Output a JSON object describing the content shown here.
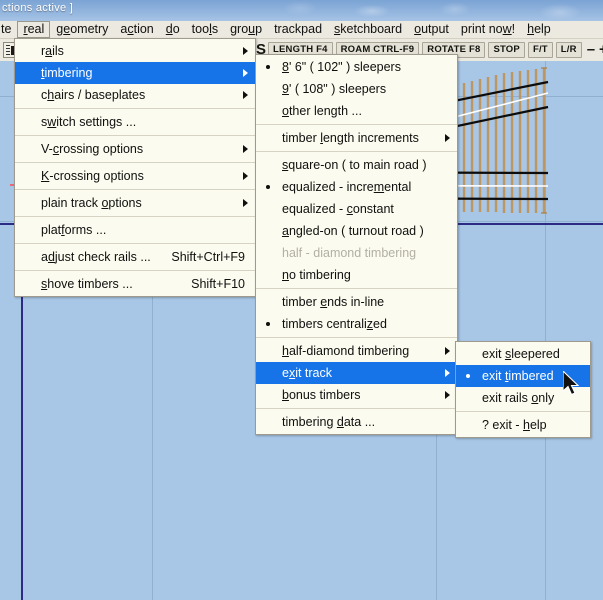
{
  "window": {
    "title_fragment": "ctions  active  ]"
  },
  "menubar": {
    "items": [
      {
        "label": "te",
        "clipped": true,
        "active": false,
        "accel": ""
      },
      {
        "label": "real",
        "clipped": false,
        "active": true,
        "accel": "r"
      },
      {
        "label": "geometry",
        "clipped": false,
        "active": false,
        "accel": "e"
      },
      {
        "label": "action",
        "clipped": false,
        "active": false,
        "accel": "c"
      },
      {
        "label": "do",
        "clipped": false,
        "active": false,
        "accel": "d"
      },
      {
        "label": "tools",
        "clipped": false,
        "active": false,
        "accel": "l"
      },
      {
        "label": "group",
        "clipped": false,
        "active": false,
        "accel": "u"
      },
      {
        "label": "trackpad",
        "clipped": false,
        "active": false,
        "accel": ""
      },
      {
        "label": "sketchboard",
        "clipped": false,
        "active": false,
        "accel": "s"
      },
      {
        "label": "output",
        "clipped": false,
        "active": false,
        "accel": "o"
      },
      {
        "label": "print now!",
        "clipped": false,
        "active": false,
        "accel": "w"
      },
      {
        "label": "help",
        "clipped": false,
        "active": false,
        "accel": "h"
      }
    ]
  },
  "toolbar": {
    "clipped_label": "S",
    "buttons": [
      {
        "label": "LENGTH  F4",
        "name": "length-f4-button"
      },
      {
        "label": "ROAM  CTRL-F9",
        "name": "roam-ctrl-f9-button"
      },
      {
        "label": "ROTATE  F8",
        "name": "rotate-f8-button"
      },
      {
        "label": "STOP",
        "name": "stop-button"
      },
      {
        "label": "F/T",
        "name": "f-over-t-button"
      },
      {
        "label": "L/R",
        "name": "l-over-r-button"
      }
    ],
    "zoom_out": "–",
    "zoom_in": "+",
    "flip_icon": "◀▶",
    "adjust_icon": "+"
  },
  "menu_real": {
    "items": [
      {
        "label": "rails",
        "pre": "r",
        "acc": "a",
        "post": "ils",
        "arrow": true,
        "bullet": false,
        "shortcut": "",
        "sep_after": false,
        "state": "normal"
      },
      {
        "label": "timbering",
        "pre": "",
        "acc": "t",
        "post": "imbering",
        "arrow": true,
        "bullet": false,
        "shortcut": "",
        "sep_after": false,
        "state": "highlight"
      },
      {
        "label": "chairs / baseplates",
        "pre": "c",
        "acc": "h",
        "post": "airs / baseplates",
        "arrow": true,
        "bullet": false,
        "shortcut": "",
        "sep_after": true,
        "state": "normal"
      },
      {
        "label": "switch  settings ...",
        "pre": "s",
        "acc": "w",
        "post": "itch  settings ...",
        "arrow": false,
        "bullet": false,
        "shortcut": "",
        "sep_after": true,
        "state": "normal"
      },
      {
        "label": "V-crossing  options",
        "pre": "V-",
        "acc": "c",
        "post": "rossing  options",
        "arrow": true,
        "bullet": false,
        "shortcut": "",
        "sep_after": true,
        "state": "normal"
      },
      {
        "label": "K-crossing  options",
        "pre": "",
        "acc": "K",
        "post": "-crossing  options",
        "arrow": true,
        "bullet": false,
        "shortcut": "",
        "sep_after": true,
        "state": "normal"
      },
      {
        "label": "plain  track  options",
        "pre": "plain  track  ",
        "acc": "o",
        "post": "ptions",
        "arrow": true,
        "bullet": false,
        "shortcut": "",
        "sep_after": true,
        "state": "normal"
      },
      {
        "label": "platforms ...",
        "pre": "plat",
        "acc": "f",
        "post": "orms ...",
        "arrow": false,
        "bullet": false,
        "shortcut": "",
        "sep_after": true,
        "state": "normal"
      },
      {
        "label": "adjust  check  rails ...",
        "pre": "a",
        "acc": "d",
        "post": "just  check  rails ...",
        "arrow": false,
        "bullet": false,
        "shortcut": "Shift+Ctrl+F9",
        "sep_after": true,
        "state": "normal"
      },
      {
        "label": "shove  timbers ...",
        "pre": "",
        "acc": "s",
        "post": "hove  timbers ...",
        "arrow": false,
        "bullet": false,
        "shortcut": "Shift+F10",
        "sep_after": false,
        "state": "normal"
      }
    ]
  },
  "menu_timbering": {
    "items": [
      {
        "label": "8' 6\"  ( 102\" )  sleepers",
        "pre": "",
        "acc": "8",
        "post": "' 6\"  ( 102\" )  sleepers",
        "arrow": false,
        "bullet": true,
        "sep_after": false,
        "state": "normal"
      },
      {
        "label": "9'  ( 108\" )  sleepers",
        "pre": "",
        "acc": "9",
        "post": "'  ( 108\" )  sleepers",
        "arrow": false,
        "bullet": false,
        "sep_after": false,
        "state": "normal"
      },
      {
        "label": "other  length ...",
        "pre": "",
        "acc": "o",
        "post": "ther  length ...",
        "arrow": false,
        "bullet": false,
        "sep_after": true,
        "state": "normal"
      },
      {
        "label": "timber  length  increments",
        "pre": "timber  ",
        "acc": "l",
        "post": "ength  increments",
        "arrow": true,
        "bullet": false,
        "sep_after": true,
        "state": "normal"
      },
      {
        "label": "square-on  ( to  main  road )",
        "pre": "",
        "acc": "s",
        "post": "quare-on  ( to  main  road )",
        "arrow": false,
        "bullet": false,
        "sep_after": false,
        "state": "normal"
      },
      {
        "label": "equalized - incremental",
        "pre": "equalized - incre",
        "acc": "m",
        "post": "ental",
        "arrow": false,
        "bullet": true,
        "sep_after": false,
        "state": "normal"
      },
      {
        "label": "equalized - constant",
        "pre": "equalized - ",
        "acc": "c",
        "post": "onstant",
        "arrow": false,
        "bullet": false,
        "sep_after": false,
        "state": "normal"
      },
      {
        "label": "angled-on  ( turnout  road )",
        "pre": "",
        "acc": "a",
        "post": "ngled-on  ( turnout  road )",
        "arrow": false,
        "bullet": false,
        "sep_after": false,
        "state": "normal"
      },
      {
        "label": "half - diamond  timbering",
        "pre": "half - diamond  timbering",
        "acc": "",
        "post": "",
        "arrow": false,
        "bullet": false,
        "sep_after": false,
        "state": "disabled"
      },
      {
        "label": "no  timbering",
        "pre": "",
        "acc": "n",
        "post": "o  timbering",
        "arrow": false,
        "bullet": false,
        "sep_after": true,
        "state": "normal"
      },
      {
        "label": "timber  ends  in-line",
        "pre": "timber  ",
        "acc": "e",
        "post": "nds  in-line",
        "arrow": false,
        "bullet": false,
        "sep_after": false,
        "state": "normal"
      },
      {
        "label": "timbers  centralized",
        "pre": "timbers  centrali",
        "acc": "z",
        "post": "ed",
        "arrow": false,
        "bullet": true,
        "sep_after": true,
        "state": "normal"
      },
      {
        "label": "half-diamond  timbering",
        "pre": "",
        "acc": "h",
        "post": "alf-diamond  timbering",
        "arrow": true,
        "bullet": false,
        "sep_after": false,
        "state": "normal"
      },
      {
        "label": "exit  track",
        "pre": "e",
        "acc": "x",
        "post": "it  track",
        "arrow": true,
        "bullet": false,
        "sep_after": false,
        "state": "highlight"
      },
      {
        "label": "bonus  timbers",
        "pre": "",
        "acc": "b",
        "post": "onus  timbers",
        "arrow": true,
        "bullet": false,
        "sep_after": true,
        "state": "normal"
      },
      {
        "label": "timbering  data ...",
        "pre": "timbering  ",
        "acc": "d",
        "post": "ata ...",
        "arrow": false,
        "bullet": false,
        "sep_after": false,
        "state": "normal"
      }
    ]
  },
  "menu_exit_track": {
    "items": [
      {
        "label": "exit  sleepered",
        "pre": "exit  ",
        "acc": "s",
        "post": "leepered",
        "bullet": false,
        "sep_after": false,
        "state": "normal"
      },
      {
        "label": "exit  timbered",
        "pre": "exit  ",
        "acc": "t",
        "post": "imbered",
        "bullet": true,
        "sep_after": false,
        "state": "highlight"
      },
      {
        "label": "exit  rails  only",
        "pre": "exit  rails  ",
        "acc": "o",
        "post": "nly",
        "bullet": false,
        "sep_after": true,
        "state": "normal"
      },
      {
        "label": "?  exit  -  help",
        "pre": "?  exit  -  ",
        "acc": "h",
        "post": "elp",
        "bullet": false,
        "sep_after": false,
        "state": "normal"
      }
    ]
  },
  "canvas": {
    "background_color": "#a8c6e6",
    "grid_color": "#8fb0d0",
    "axis_color": "#2b2b86",
    "rail_color": "#101010",
    "timber_color": "#c09050",
    "centreline_color": "#ffffff",
    "origin_marker_color": "#e8505f",
    "start_dot_color": "#17a117",
    "description": "turnout drawing with timbers, rails and centre-lines"
  },
  "cursor": {
    "name": "mouse-pointer"
  }
}
